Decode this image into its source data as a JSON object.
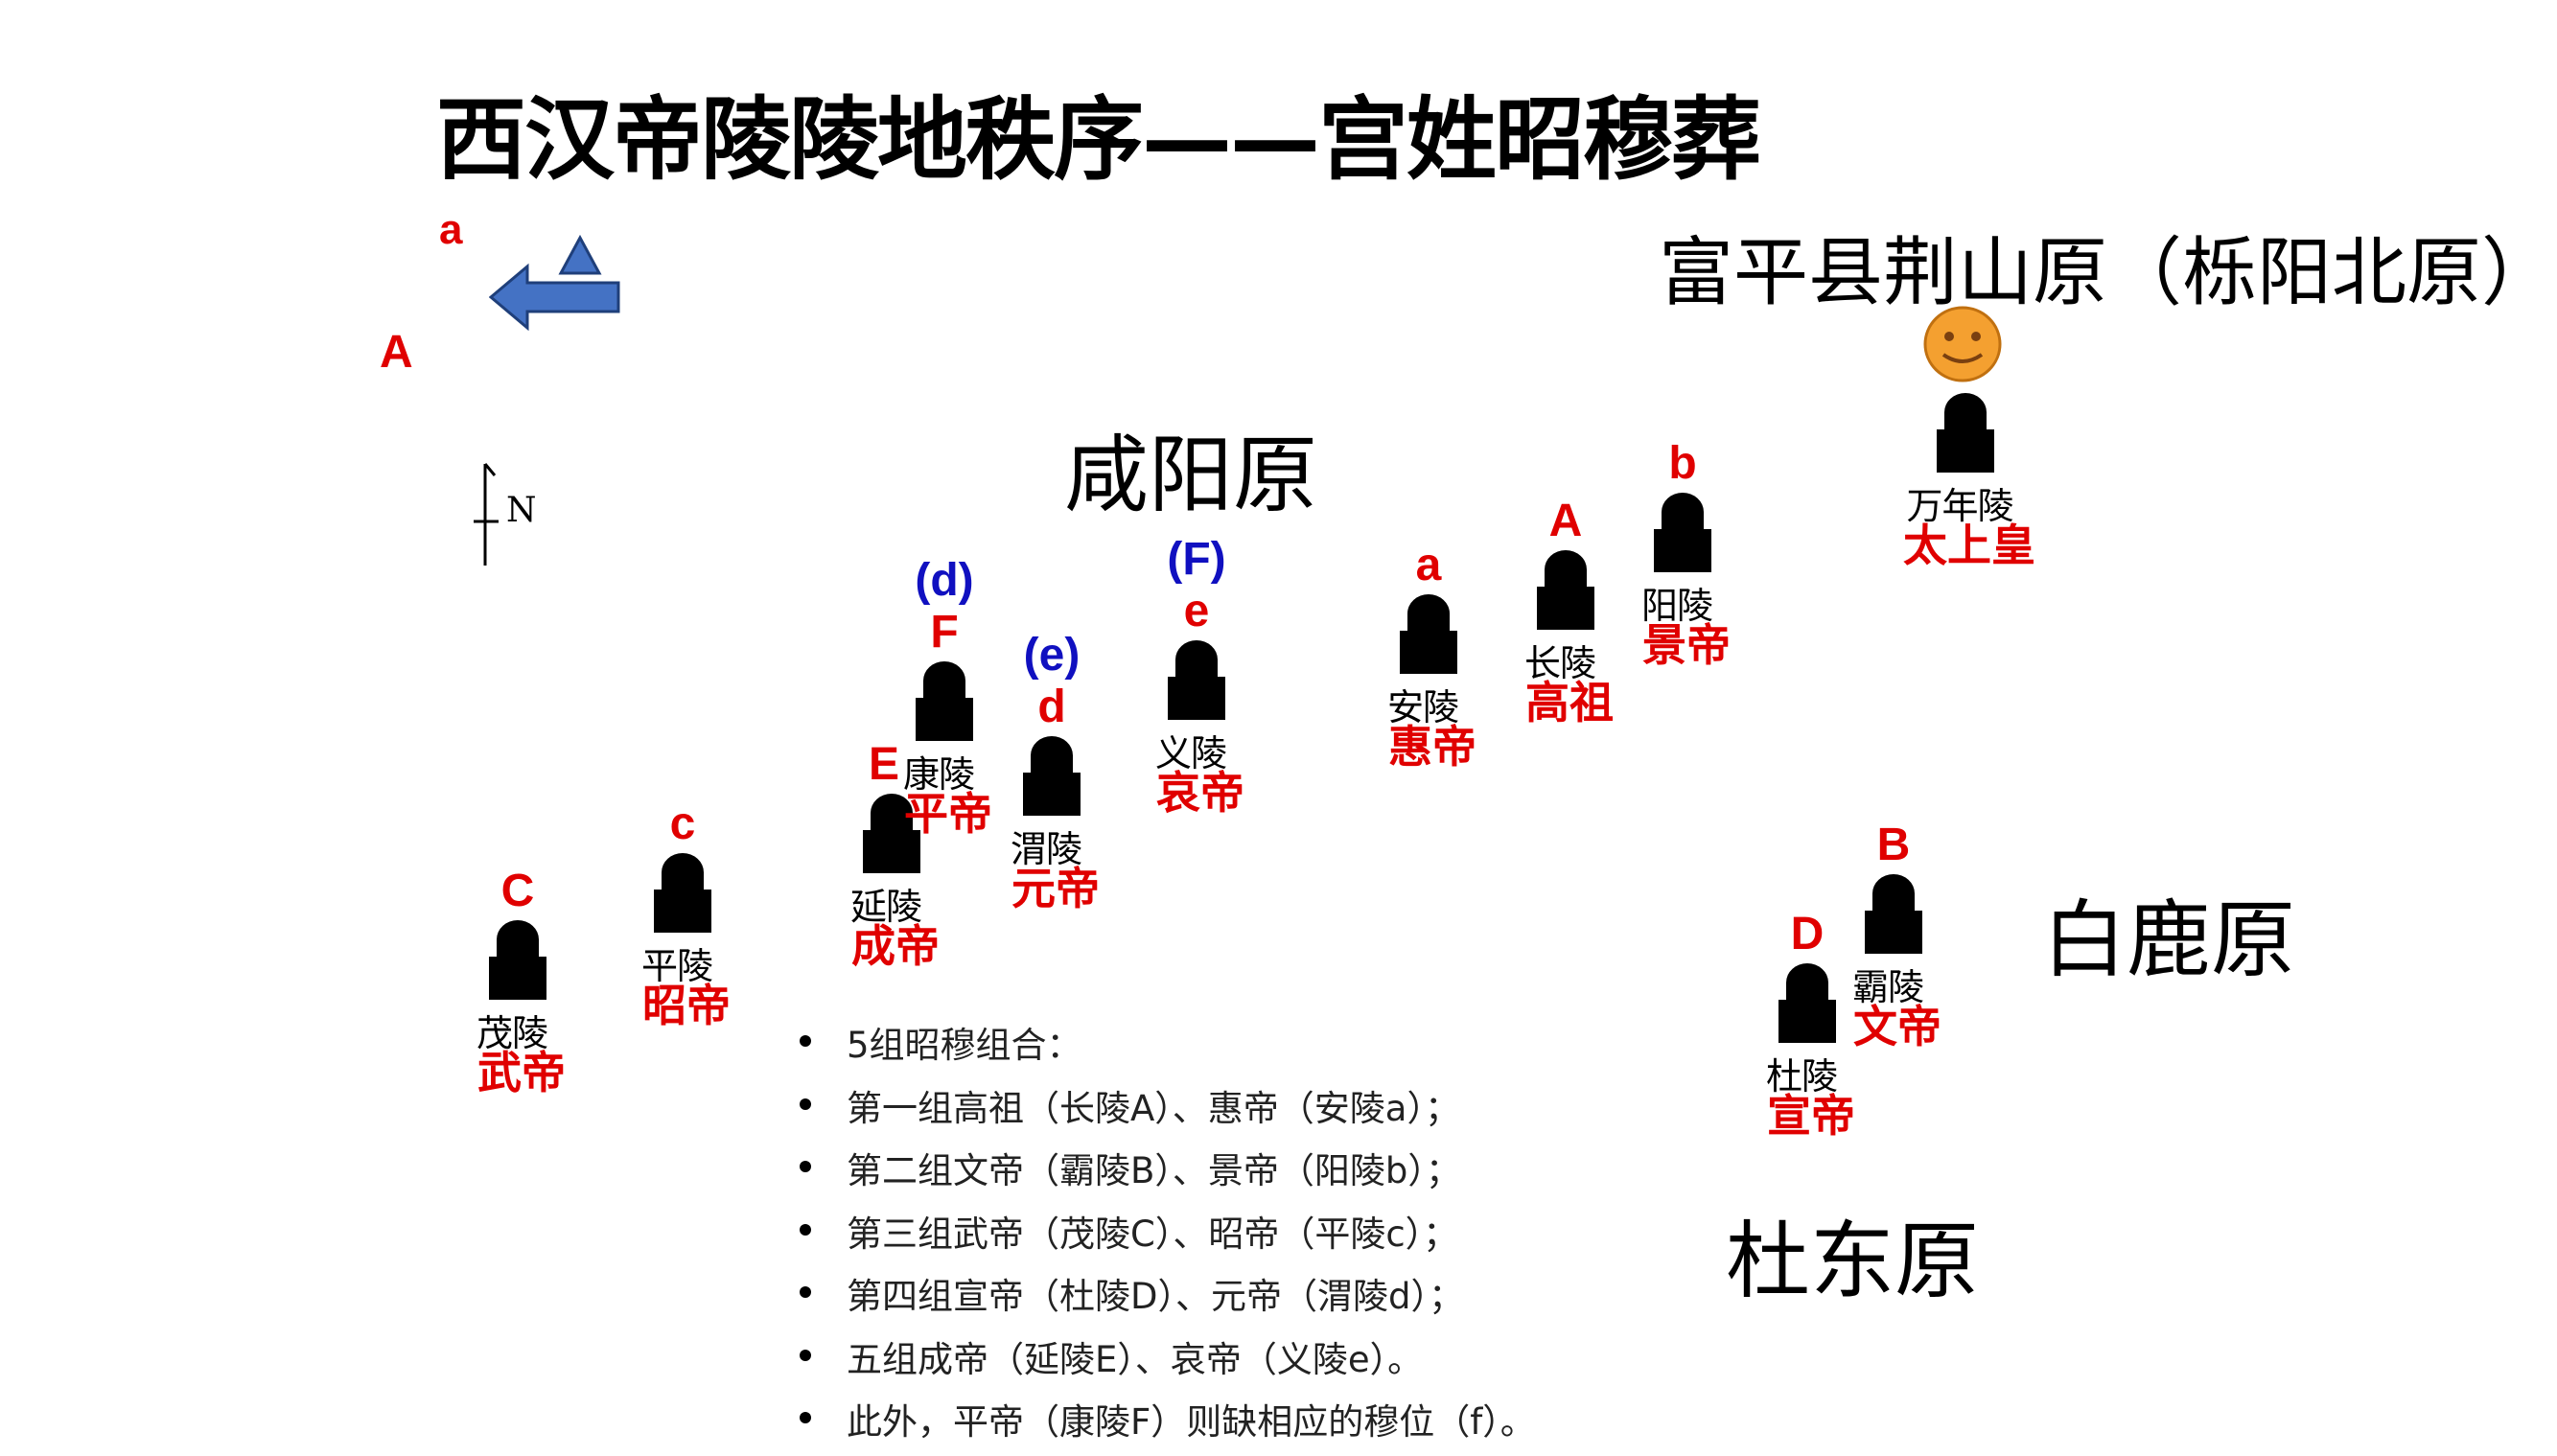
{
  "title": "西汉帝陵陵地秩序——宫姓昭穆葬",
  "regions": {
    "jingshan": "富平县荆山原（栎阳北原）",
    "xianyang": "咸阳原",
    "bailu": "白鹿原",
    "dudong": "杜东原"
  },
  "legend": {
    "letter_a": "a",
    "letter_A": "A",
    "north": "N"
  },
  "colors": {
    "red": "#e00000",
    "blue": "#1010c0",
    "arrow": "#4472c4",
    "smiley": "#f4a030"
  },
  "tombs": [
    {
      "id": "maoling",
      "name": "茂陵",
      "emperor": "武帝",
      "tag": "C",
      "alt_tag": ""
    },
    {
      "id": "pingling",
      "name": "平陵",
      "emperor": "昭帝",
      "tag": "c",
      "alt_tag": ""
    },
    {
      "id": "yanling",
      "name": "延陵",
      "emperor": "成帝",
      "tag": "E",
      "alt_tag": ""
    },
    {
      "id": "kangling",
      "name": "康陵",
      "emperor": "平帝",
      "tag": "F",
      "alt_tag": "(d)"
    },
    {
      "id": "weiling",
      "name": "渭陵",
      "emperor": "元帝",
      "tag": "d",
      "alt_tag": "(e)"
    },
    {
      "id": "yiling",
      "name": "义陵",
      "emperor": "哀帝",
      "tag": "e",
      "alt_tag": "(F)"
    },
    {
      "id": "anling",
      "name": "安陵",
      "emperor": "惠帝",
      "tag": "a",
      "alt_tag": ""
    },
    {
      "id": "changling",
      "name": "长陵",
      "emperor": "高祖",
      "tag": "A",
      "alt_tag": ""
    },
    {
      "id": "yangling",
      "name": "阳陵",
      "emperor": "景帝",
      "tag": "b",
      "alt_tag": ""
    },
    {
      "id": "wannianling",
      "name": "万年陵",
      "emperor": "太上皇",
      "tag": "",
      "alt_tag": ""
    },
    {
      "id": "baling",
      "name": "霸陵",
      "emperor": "文帝",
      "tag": "B",
      "alt_tag": ""
    },
    {
      "id": "duling",
      "name": "杜陵",
      "emperor": "宣帝",
      "tag": "D",
      "alt_tag": ""
    }
  ],
  "notes": [
    "5组昭穆组合：",
    "第一组高祖（长陵A）、惠帝（安陵a）；",
    "第二组文帝（霸陵B）、景帝（阳陵b）；",
    "第三组武帝（茂陵C）、昭帝（平陵c）；",
    "第四组宣帝（杜陵D）、元帝（渭陵d）；",
    "五组成帝（延陵E）、哀帝（义陵e）。",
    "此外，平帝（康陵F）则缺相应的穆位（f）。"
  ]
}
